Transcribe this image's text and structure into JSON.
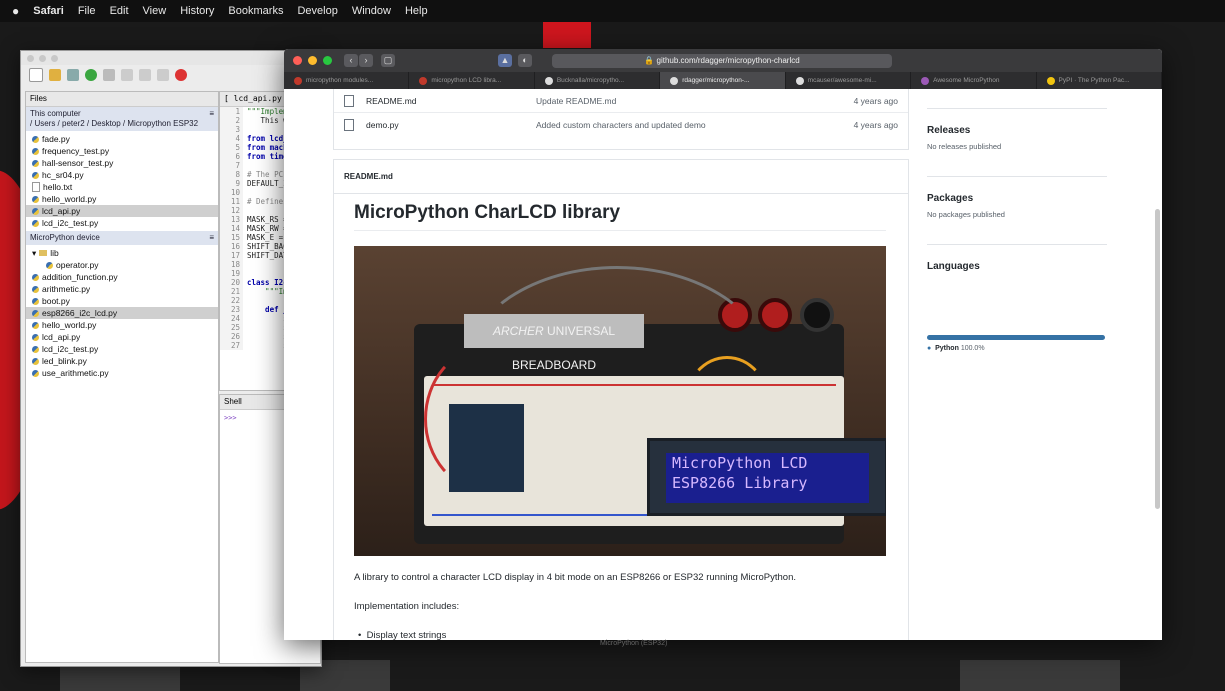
{
  "menubar": {
    "app": "Safari",
    "items": [
      "File",
      "Edit",
      "View",
      "History",
      "Bookmarks",
      "Develop",
      "Window",
      "Help"
    ]
  },
  "thonny": {
    "files_tab": "Files",
    "editor_tab": "[ lcd_api.py ]",
    "this_computer_header": "This computer",
    "path": "/ Users / peter2 / Desktop / Micropython ESP32",
    "computer_files": [
      "fade.py",
      "frequency_test.py",
      "hall-sensor_test.py",
      "hc_sr04.py",
      "hello.txt",
      "hello_world.py",
      "lcd_api.py",
      "lcd_i2c_test.py"
    ],
    "device_header": "MicroPython device",
    "device_folder": "lib",
    "device_files": [
      "operator.py",
      "addition_function.py",
      "arithmetic.py",
      "boot.py",
      "esp8266_i2c_lcd.py",
      "hello_world.py",
      "lcd_api.py",
      "lcd_i2c_test.py",
      "led_blink.py",
      "use_arithmetic.py"
    ],
    "code_lines": [
      "\"\"\"Implem",
      "   This w",
      "",
      "from lcd_",
      "from mach",
      "from time",
      "",
      "# The PCF",
      "DEFAULT_I",
      "",
      "# Defines",
      "",
      "MASK_RS =",
      "MASK_RW =",
      "MASK_E =",
      "SHIFT_BAC",
      "SHIFT_DAT",
      "",
      "",
      "class I2c",
      "    \"\"\"Im",
      "",
      "    def _",
      "        s",
      "        s",
      "        s",
      "        s"
    ],
    "shell_tab": "Shell",
    "shell_prompt": ">>>",
    "status": "MicroPython (ESP32)"
  },
  "safari": {
    "url": "github.com/rdagger/micropython-charlcd",
    "tabs": [
      {
        "label": "micropython modules...",
        "color": "#c0392b"
      },
      {
        "label": "micropython LCD libra...",
        "color": "#c0392b"
      },
      {
        "label": "Bucknalla/micropytho...",
        "color": "#dddddd"
      },
      {
        "label": "rdagger/micropython-...",
        "color": "#dddddd"
      },
      {
        "label": "mcauser/awesome-mi...",
        "color": "#dddddd"
      },
      {
        "label": "Awesome MicroPython",
        "color": "#9b59b6"
      },
      {
        "label": "PyPI · The Python Pac...",
        "color": "#f1c40f"
      }
    ]
  },
  "repo": {
    "files": [
      {
        "name": "README.md",
        "message": "Update README.md",
        "age": "4 years ago"
      },
      {
        "name": "demo.py",
        "message": "Added custom characters and updated demo",
        "age": "4 years ago"
      }
    ],
    "readme_label": "README.md",
    "title": "MicroPython CharLCD library",
    "photo": {
      "brand_line1": "ARCHER",
      "brand_line2": "UNIVERSAL BREADBOARD",
      "lcd_line1": "MicroPython LCD",
      "lcd_line2": "ESP8266 Library"
    },
    "description": "A library to control a character LCD display in 4 bit mode on an ESP8266 or ESP32 running MicroPython.",
    "impl_label": "Implementation includes:",
    "bullet1": "Display text strings"
  },
  "sidebar": {
    "releases_title": "Releases",
    "releases_text": "No releases published",
    "packages_title": "Packages",
    "packages_text": "No packages published",
    "languages_title": "Languages",
    "language_name": "Python",
    "language_pct": "100.0%",
    "language_color": "#3572a5"
  }
}
